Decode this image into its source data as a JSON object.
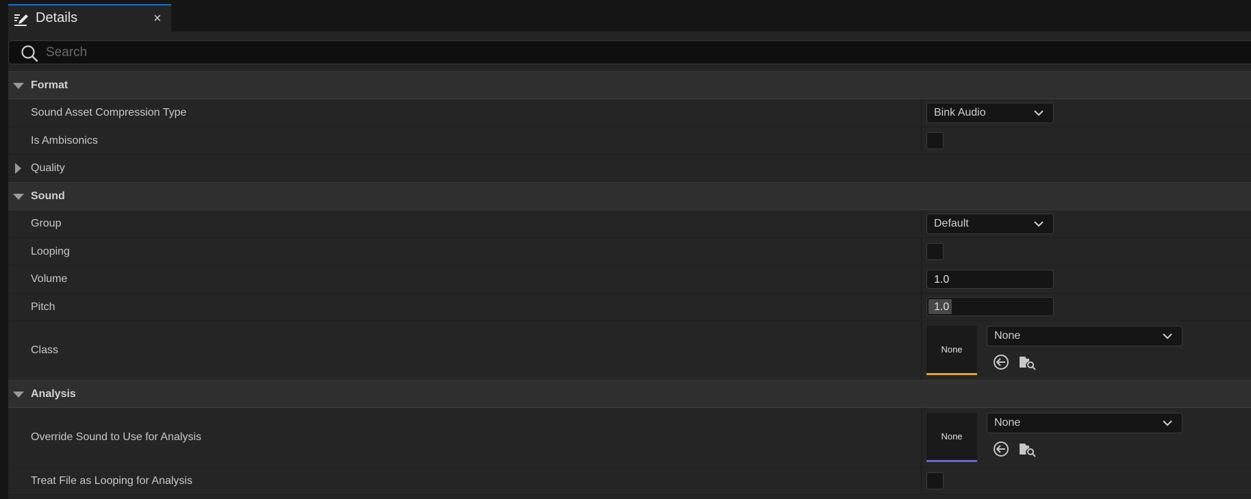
{
  "tab": {
    "title": "Details",
    "close": "×"
  },
  "search": {
    "placeholder": "Search"
  },
  "sections": {
    "format": {
      "title": "Format",
      "props": {
        "compression": {
          "label": "Sound Asset Compression Type",
          "value": "Bink Audio"
        },
        "ambisonics": {
          "label": "Is Ambisonics",
          "checked": false
        }
      },
      "quality": {
        "title": "Quality",
        "expanded": false
      }
    },
    "sound": {
      "title": "Sound",
      "props": {
        "group": {
          "label": "Group",
          "value": "Default"
        },
        "looping": {
          "label": "Looping",
          "checked": false
        },
        "volume": {
          "label": "Volume",
          "value": "1.0"
        },
        "pitch": {
          "label": "Pitch",
          "value": "1.0"
        },
        "class": {
          "label": "Class",
          "thumb": "None",
          "value": "None",
          "accent": "#d9a53a"
        }
      }
    },
    "analysis": {
      "title": "Analysis",
      "props": {
        "override": {
          "label": "Override Sound to Use for Analysis",
          "thumb": "None",
          "value": "None",
          "accent": "#6b63c9"
        },
        "treat_looping": {
          "label": "Treat File as Looping for Analysis",
          "checked": false
        }
      }
    }
  },
  "icons": {
    "tab": "edit-pencil-icon",
    "search": "search-icon",
    "expanded": "triangle-down-icon",
    "collapsed": "triangle-right-icon",
    "dropdown": "chevron-down-icon",
    "use_selected": "use-selected-arrow-icon",
    "browse": "browse-folder-icon"
  }
}
